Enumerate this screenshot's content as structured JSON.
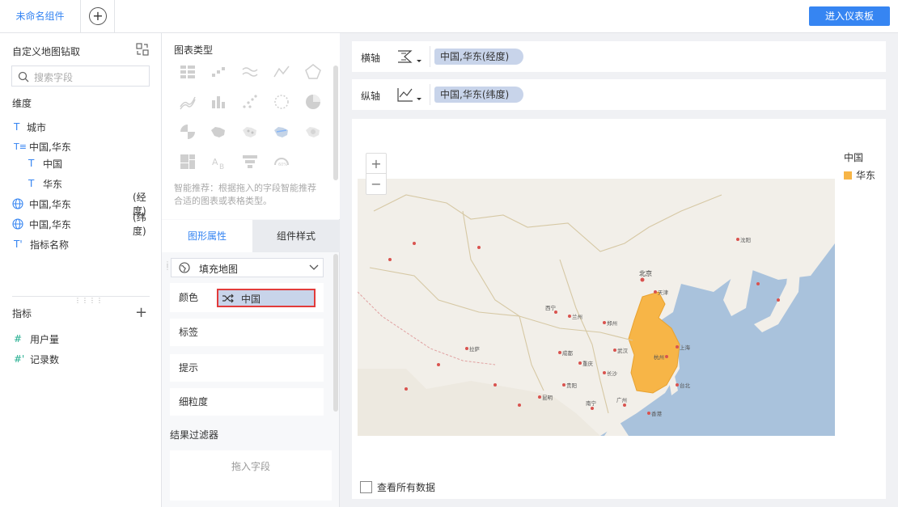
{
  "header": {
    "tab_active": "未命名组件",
    "enter_dashboard": "进入仪表板"
  },
  "left_panel": {
    "title": "自定义地图钻取",
    "search_placeholder": "搜索字段",
    "dimension_label": "维度",
    "dimensions": [
      {
        "type": "T",
        "label": "城市",
        "suffix": ""
      },
      {
        "type": "T≡",
        "label": "中国,华东",
        "suffix": ""
      },
      {
        "type": "T",
        "label": "中国",
        "suffix": ""
      },
      {
        "type": "T",
        "label": "华东",
        "suffix": ""
      },
      {
        "type": "globe",
        "label": "中国,华东",
        "suffix": "(经度)"
      },
      {
        "type": "globe",
        "label": "中国,华东",
        "suffix": "(纬度)"
      },
      {
        "type": "T'",
        "label": "指标名称",
        "suffix": ""
      }
    ],
    "metric_label": "指标",
    "metrics": [
      {
        "type": "#",
        "label": "用户量"
      },
      {
        "type": "#'",
        "label": "记录数"
      }
    ]
  },
  "middle_panel": {
    "chart_type_label": "图表类型",
    "recommend_text": "智能推荐：根据拖入的字段智能推荐合适的图表或表格类型。",
    "tab_graphic": "图形属性",
    "tab_component": "组件样式",
    "fill_map": "填充地图",
    "props": {
      "color": "颜色",
      "color_field": "中国",
      "label": "标签",
      "tooltip": "提示",
      "granularity": "细粒度"
    },
    "filter_label": "结果过滤器",
    "drop_field": "拖入字段"
  },
  "axes": {
    "x_label": "横轴",
    "x_field": "中国,华东(经度)",
    "y_label": "纵轴",
    "y_field": "中国,华东(纬度)"
  },
  "map": {
    "zoom_in": "+",
    "zoom_out": "−",
    "legend_title": "中国",
    "legend_item": "华东",
    "highlight_color": "#f7b547",
    "city_labels": [
      "北京",
      "天津",
      "上海",
      "杭州",
      "西宁",
      "兰州",
      "成都",
      "重庆",
      "拉萨",
      "广州",
      "南宁",
      "香港",
      "台北",
      "郑州",
      "武汉",
      "长沙",
      "昆明",
      "贵阳",
      "沈阳"
    ],
    "view_all": "查看所有数据"
  },
  "colors": {
    "accent": "#3685f2",
    "map_sea": "#a9c2dc",
    "map_land": "#f2efe9",
    "highlight": "#f7b547"
  }
}
